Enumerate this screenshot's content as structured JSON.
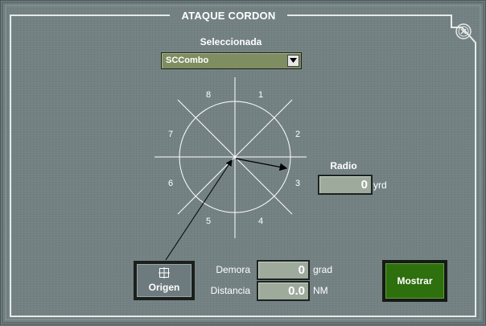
{
  "window": {
    "title": "ATAQUE CORDON",
    "close_icon": "close-circle-x-icon"
  },
  "selection": {
    "label": "Seleccionada",
    "value": "SCCombo"
  },
  "compass": {
    "sectors": [
      "1",
      "2",
      "3",
      "4",
      "5",
      "6",
      "7",
      "8"
    ]
  },
  "radio": {
    "label": "Radio",
    "value": "0",
    "unit": "yrd"
  },
  "demora": {
    "label": "Demora",
    "value": "0",
    "unit": "grad"
  },
  "distancia": {
    "label": "Distancia",
    "value": "0.0",
    "unit": "NM"
  },
  "origen_button": {
    "label": "Origen",
    "icon": "crosshair-square-icon"
  },
  "mostrar_button": {
    "label": "Mostrar",
    "color": "#2e6f0e"
  }
}
